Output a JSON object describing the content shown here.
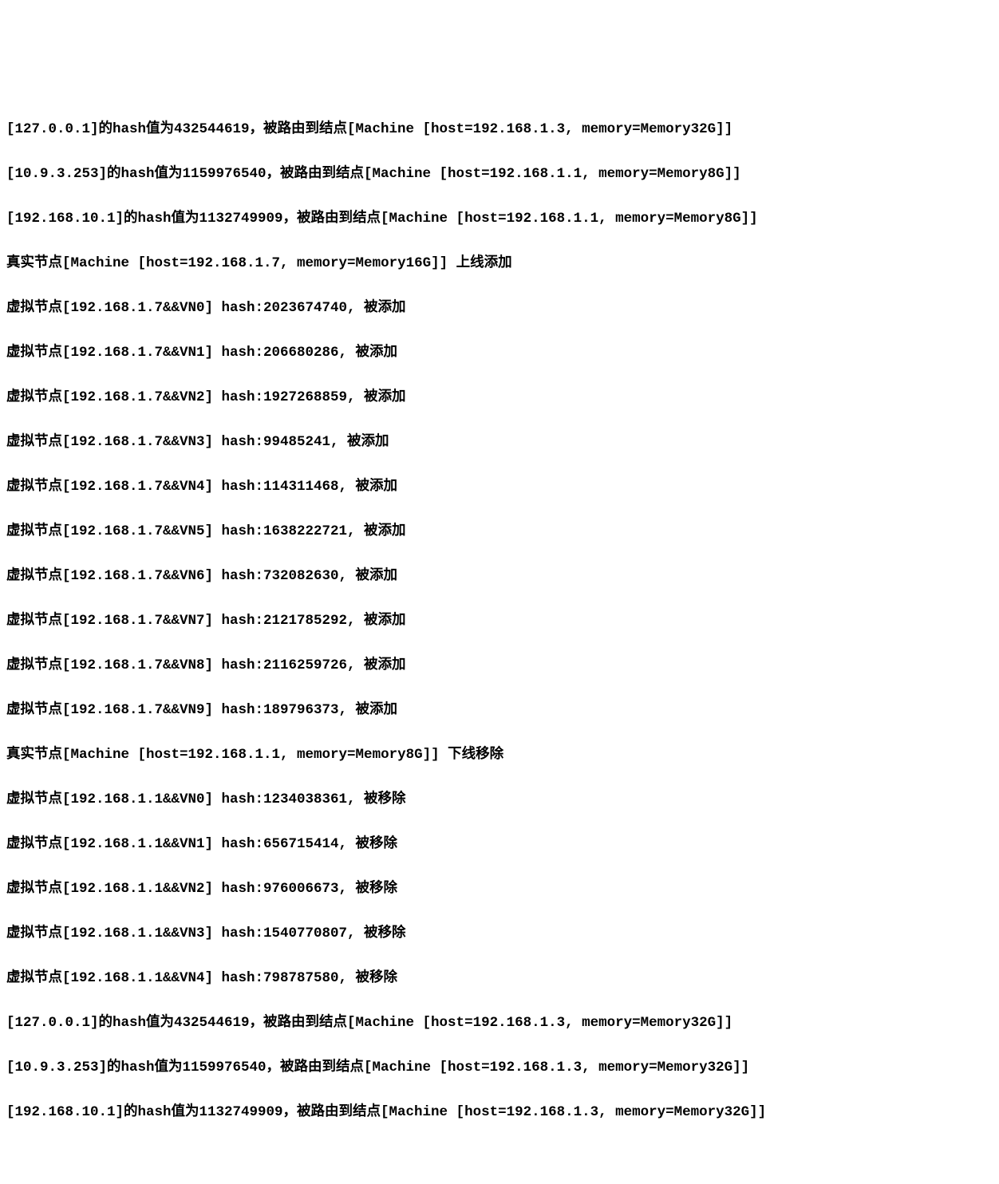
{
  "lines": [
    "[127.0.0.1]的hash值为432544619，被路由到结点[Machine [host=192.168.1.3, memory=Memory32G]]",
    "[10.9.3.253]的hash值为1159976540，被路由到结点[Machine [host=192.168.1.1, memory=Memory8G]]",
    "[192.168.10.1]的hash值为1132749909，被路由到结点[Machine [host=192.168.1.1, memory=Memory8G]]",
    "真实节点[Machine [host=192.168.1.7, memory=Memory16G]] 上线添加",
    "虚拟节点[192.168.1.7&&VN0] hash:2023674740, 被添加",
    "虚拟节点[192.168.1.7&&VN1] hash:206680286, 被添加",
    "虚拟节点[192.168.1.7&&VN2] hash:1927268859, 被添加",
    "虚拟节点[192.168.1.7&&VN3] hash:99485241, 被添加",
    "虚拟节点[192.168.1.7&&VN4] hash:114311468, 被添加",
    "虚拟节点[192.168.1.7&&VN5] hash:1638222721, 被添加",
    "虚拟节点[192.168.1.7&&VN6] hash:732082630, 被添加",
    "虚拟节点[192.168.1.7&&VN7] hash:2121785292, 被添加",
    "虚拟节点[192.168.1.7&&VN8] hash:2116259726, 被添加",
    "虚拟节点[192.168.1.7&&VN9] hash:189796373, 被添加",
    "真实节点[Machine [host=192.168.1.1, memory=Memory8G]] 下线移除",
    "虚拟节点[192.168.1.1&&VN0] hash:1234038361, 被移除",
    "虚拟节点[192.168.1.1&&VN1] hash:656715414, 被移除",
    "虚拟节点[192.168.1.1&&VN2] hash:976006673, 被移除",
    "虚拟节点[192.168.1.1&&VN3] hash:1540770807, 被移除",
    "虚拟节点[192.168.1.1&&VN4] hash:798787580, 被移除",
    "[127.0.0.1]的hash值为432544619，被路由到结点[Machine [host=192.168.1.3, memory=Memory32G]]",
    "[10.9.3.253]的hash值为1159976540，被路由到结点[Machine [host=192.168.1.3, memory=Memory32G]]",
    "[192.168.10.1]的hash值为1132749909，被路由到结点[Machine [host=192.168.1.3, memory=Memory32G]]"
  ]
}
